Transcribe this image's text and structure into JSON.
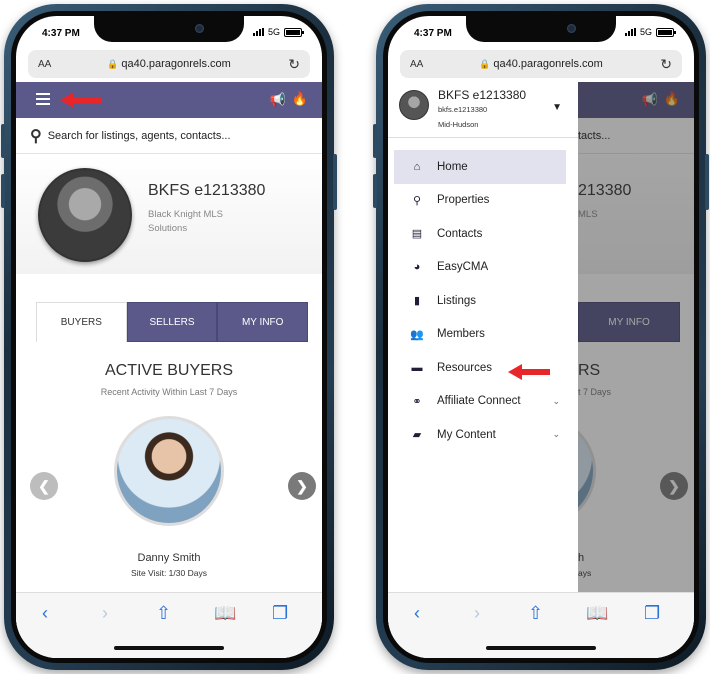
{
  "status": {
    "time": "4:37 PM",
    "network": "5G"
  },
  "browser": {
    "aa": "AA",
    "url": "qa40.paragonrels.com",
    "reload": "↻"
  },
  "left_phone": {
    "search_placeholder": "Search for listings, agents, contacts...",
    "profile": {
      "name": "BKFS e1213380",
      "company_line1": "Black Knight MLS",
      "company_line2": "Solutions"
    },
    "tabs": [
      "BUYERS",
      "SELLERS",
      "MY INFO"
    ],
    "section_title": "ACTIVE BUYERS",
    "section_subtitle": "Recent Activity Within Last 7 Days",
    "buyer": {
      "name": "Danny Smith",
      "visit": "Site Visit: 1/30 Days"
    }
  },
  "right_phone": {
    "bg_search": "tacts...",
    "bg_name": "213380",
    "bg_comp": "MLS",
    "bg_tab": "MY INFO",
    "bg_title": "RS",
    "bg_sub": "t 7 Days",
    "bg_name2": "h",
    "bg_visit": "ays",
    "drawer": {
      "name": "BKFS e1213380",
      "username": "bkfs.e1213380",
      "mls": "Mid-Hudson",
      "items": [
        {
          "label": "Home",
          "icon": "home-icon",
          "glyph": "⌂",
          "active": true
        },
        {
          "label": "Properties",
          "icon": "search-icon",
          "glyph": "⚲"
        },
        {
          "label": "Contacts",
          "icon": "contact-card-icon",
          "glyph": "▤"
        },
        {
          "label": "EasyCMA",
          "icon": "pie-chart-icon",
          "glyph": "◕"
        },
        {
          "label": "Listings",
          "icon": "document-icon",
          "glyph": "▮"
        },
        {
          "label": "Members",
          "icon": "people-icon",
          "glyph": "👥"
        },
        {
          "label": "Resources",
          "icon": "book-icon",
          "glyph": "▬"
        },
        {
          "label": "Affiliate Connect",
          "icon": "handshake-icon",
          "glyph": "⚭",
          "expand": true
        },
        {
          "label": "My Content",
          "icon": "folder-icon",
          "glyph": "▰",
          "expand": true
        }
      ]
    }
  },
  "colors": {
    "header": "#5b5989",
    "accent_red": "#e8262a",
    "ios_blue": "#2a73d8"
  }
}
